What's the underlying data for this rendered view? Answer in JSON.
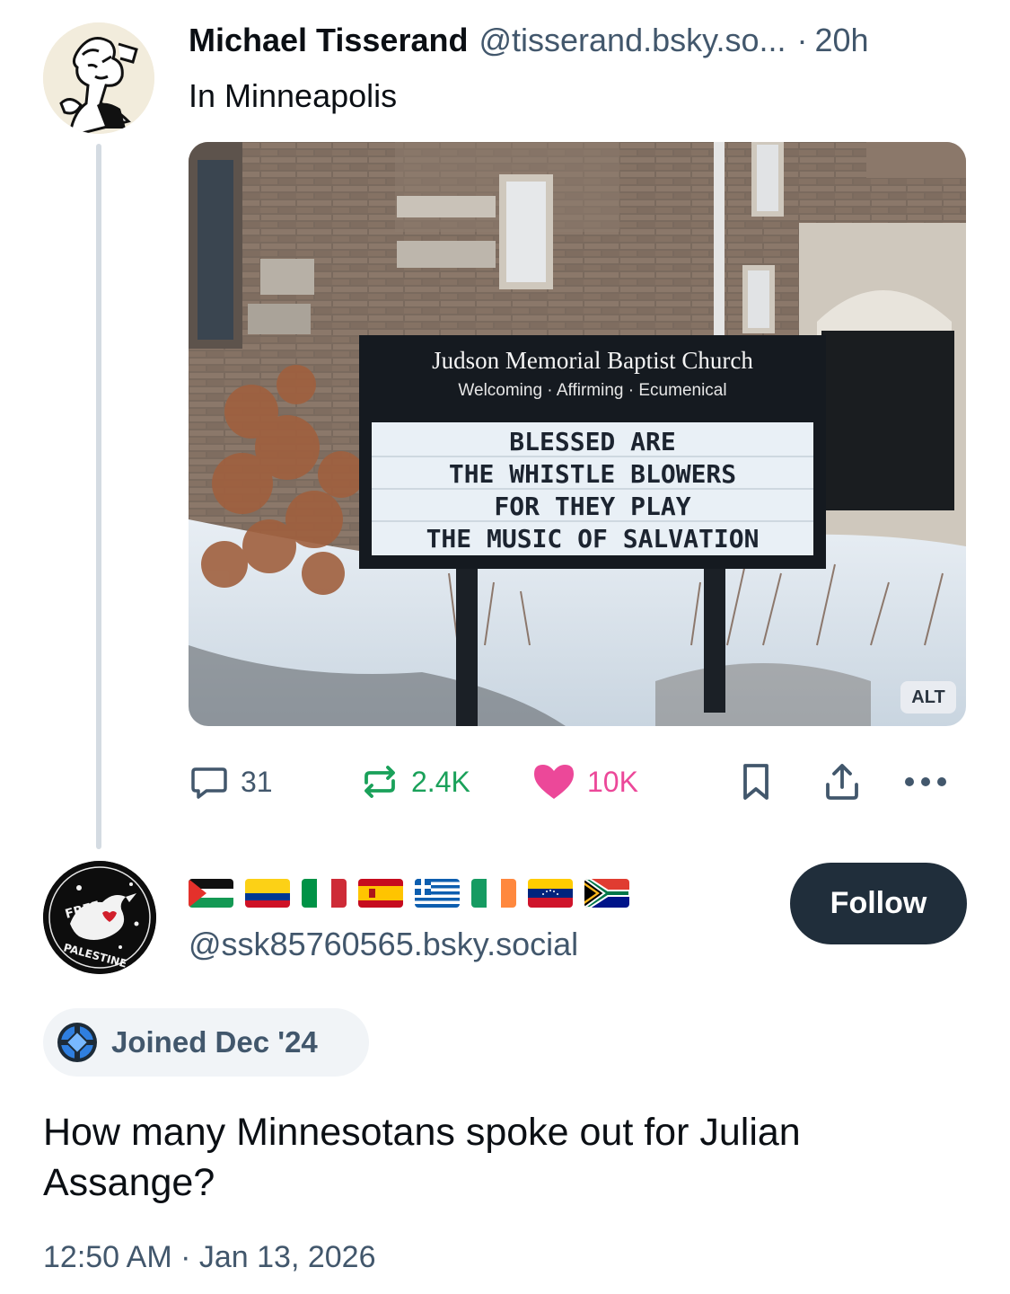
{
  "parent_post": {
    "author_name": "Michael Tisserand",
    "author_handle": "@tisserand.bsky.so...",
    "separator": "·",
    "time": "20h",
    "text": "In Minneapolis",
    "image": {
      "alt_badge": "ALT",
      "sign_title": "Judson Memorial Baptist Church",
      "sign_subtitle": "Welcoming · Affirming · Ecumenical",
      "sign_lines": [
        "BLESSED  ARE",
        "THE WHISTLE BLOWERS",
        "FOR THEY PLAY",
        "THE  MUSIC OF SALVATION"
      ]
    },
    "actions": {
      "reply_count": "31",
      "repost_count": "2.4K",
      "like_count": "10K",
      "bookmark_icon": "bookmark-icon",
      "share_icon": "share-icon",
      "more_icon": "more-icon"
    },
    "colors": {
      "repost": "#1aa15a",
      "like": "#ec4899",
      "meta": "#42576c"
    }
  },
  "reply_post": {
    "display_name_flags": [
      "Palestine",
      "Colombia",
      "Italy",
      "Spain",
      "Greece",
      "Ireland",
      "Venezuela",
      "South Africa"
    ],
    "handle": "@ssk85760565.bsky.social",
    "follow_label": "Follow",
    "joined_label": "Joined Dec '24",
    "avatar_text_top": "FREE",
    "avatar_text_bottom": "PALESTINE",
    "text": "How many Minnesotans spoke out for Julian Assange?",
    "timestamp": "12:50 AM · Jan 13, 2026"
  }
}
